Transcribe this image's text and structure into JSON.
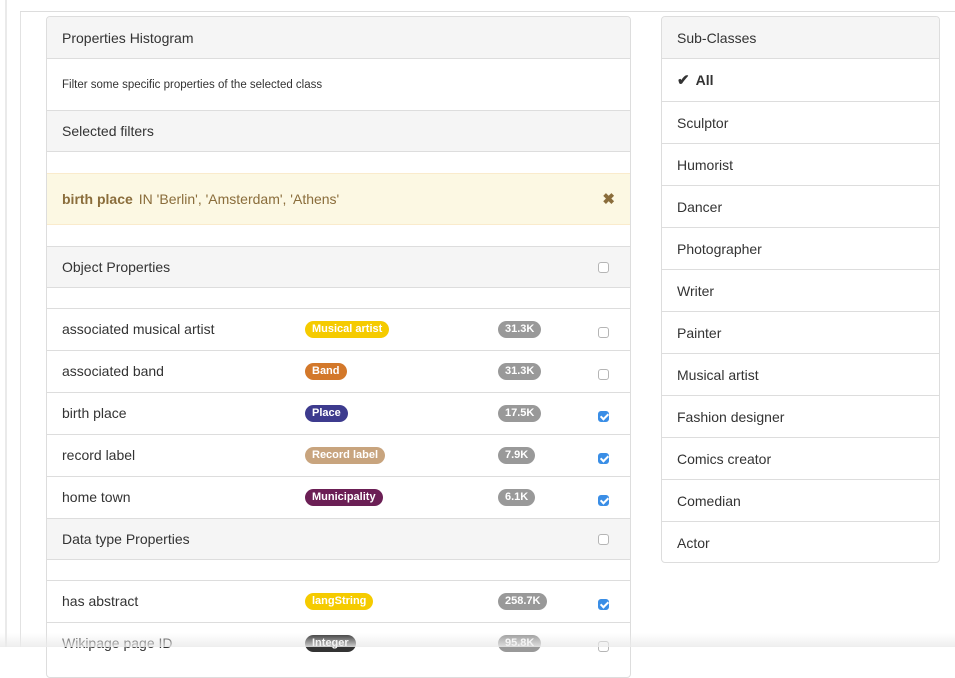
{
  "histogram": {
    "title": "Properties Histogram",
    "description": "Filter some specific properties of the selected class",
    "selected_filters_title": "Selected filters",
    "filter": {
      "property": "birth place",
      "condition": "IN 'Berlin', 'Amsterdam', 'Athens'",
      "remove_icon": "close-icon"
    },
    "object_properties": {
      "title": "Object Properties",
      "checked": false,
      "rows": [
        {
          "name": "associated musical artist",
          "type": "Musical artist",
          "type_color": "#f5cb00",
          "count": "31.3K",
          "checked": false
        },
        {
          "name": "associated band",
          "type": "Band",
          "type_color": "#d3782a",
          "count": "31.3K",
          "checked": false
        },
        {
          "name": "birth place",
          "type": "Place",
          "type_color": "#3d3b8e",
          "count": "17.5K",
          "checked": true
        },
        {
          "name": "record label",
          "type": "Record label",
          "type_color": "#c8a47e",
          "count": "7.9K",
          "checked": true
        },
        {
          "name": "home town",
          "type": "Municipality",
          "type_color": "#6b1f55",
          "count": "6.1K",
          "checked": true
        }
      ]
    },
    "datatype_properties": {
      "title": "Data type Properties",
      "checked": false,
      "rows": [
        {
          "name": "has abstract",
          "type": "langString",
          "type_color": "#f5cb00",
          "count": "258.7K",
          "checked": true
        },
        {
          "name": "Wikipage page ID",
          "type": "Integer",
          "type_color": "#333333",
          "count": "95.8K",
          "checked": false
        }
      ]
    }
  },
  "subclasses": {
    "title": "Sub-Classes",
    "items": [
      {
        "label": "All",
        "active": true,
        "icon": "check-icon"
      },
      {
        "label": "Sculptor"
      },
      {
        "label": "Humorist"
      },
      {
        "label": "Dancer"
      },
      {
        "label": "Photographer"
      },
      {
        "label": "Writer"
      },
      {
        "label": "Painter"
      },
      {
        "label": "Musical artist"
      },
      {
        "label": "Fashion designer"
      },
      {
        "label": "Comics creator"
      },
      {
        "label": "Comedian"
      },
      {
        "label": "Actor"
      }
    ]
  }
}
